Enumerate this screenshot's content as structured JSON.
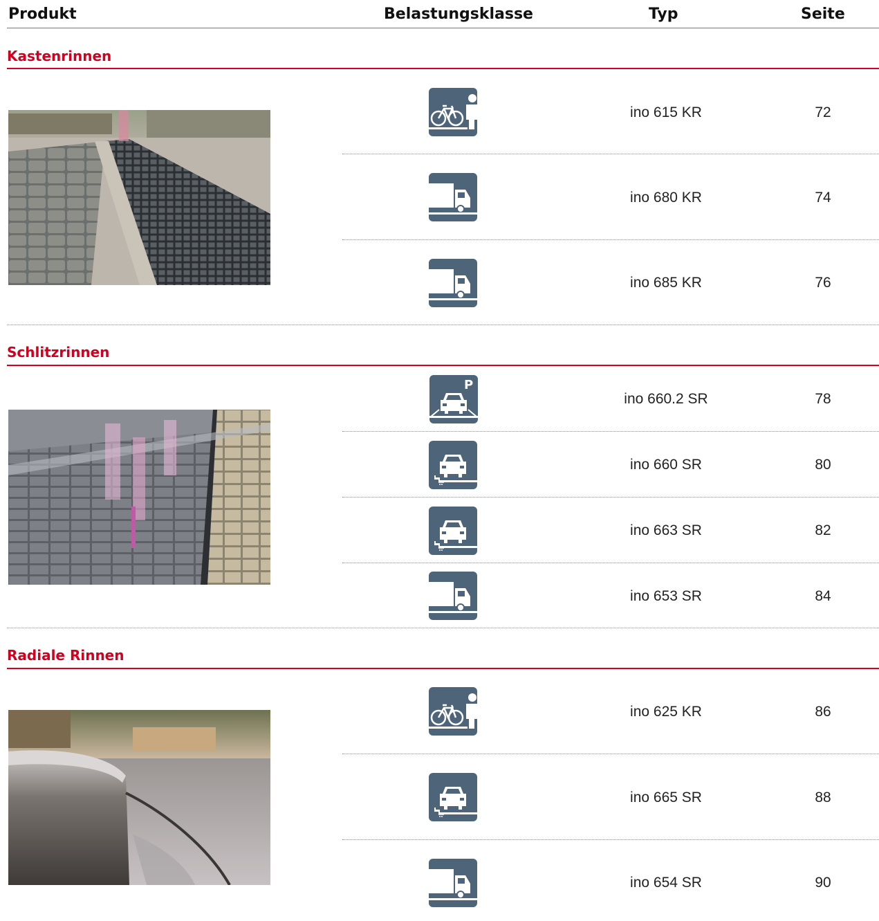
{
  "header": {
    "produkt": "Produkt",
    "belastungsklasse": "Belastungsklasse",
    "typ": "Typ",
    "seite": "Seite"
  },
  "sections": [
    {
      "title": "Kastenrinnen",
      "rows": [
        {
          "icon": "bicycle-pedestrian-icon",
          "typ": "ino 615 KR",
          "seite": "72"
        },
        {
          "icon": "truck-icon",
          "typ": "ino 680 KR",
          "seite": "74"
        },
        {
          "icon": "truck-icon",
          "typ": "ino 685 KR",
          "seite": "76"
        }
      ]
    },
    {
      "title": "Schlitzrinnen",
      "rows": [
        {
          "icon": "parking-car-icon",
          "typ": "ino 660.2 SR",
          "seite": "78"
        },
        {
          "icon": "car-icon",
          "typ": "ino 660 SR",
          "seite": "80"
        },
        {
          "icon": "car-icon",
          "typ": "ino 663 SR",
          "seite": "82"
        },
        {
          "icon": "truck-icon",
          "typ": "ino 653 SR",
          "seite": "84"
        }
      ]
    },
    {
      "title": "Radiale Rinnen",
      "rows": [
        {
          "icon": "bicycle-pedestrian-icon",
          "typ": "ino 625 KR",
          "seite": "86"
        },
        {
          "icon": "car-icon",
          "typ": "ino 665 SR",
          "seite": "88"
        },
        {
          "icon": "truck-icon",
          "typ": "ino 654 SR",
          "seite": "90"
        }
      ]
    }
  ],
  "colors": {
    "accent_red": "#d2001e",
    "icon_blue": "#4d6479"
  }
}
